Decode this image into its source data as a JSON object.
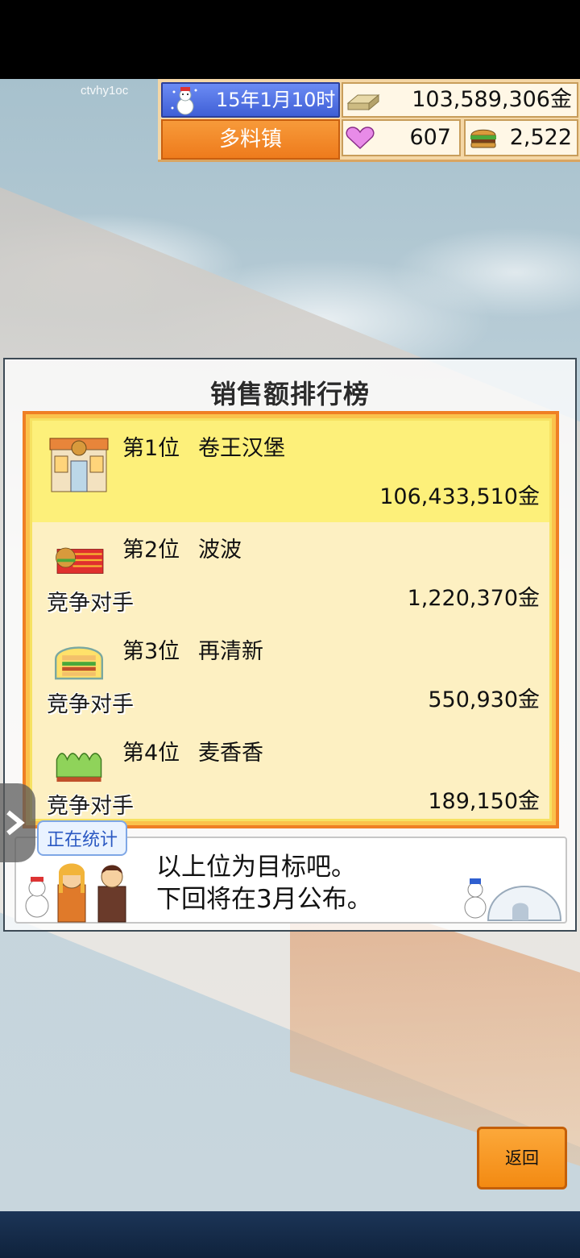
{
  "watermark": "ctvhy1oc",
  "hud": {
    "date": "15年1月10时",
    "town": "多料镇",
    "money": "103,589,306金",
    "hearts": "607",
    "burgers": "2,522"
  },
  "dialog": {
    "title": "销售额排行榜",
    "rankings": [
      {
        "pos": "第1位",
        "name": "卷王汉堡",
        "amount": "106,433,510金",
        "tag": ""
      },
      {
        "pos": "第2位",
        "name": "波波",
        "amount": "1,220,370金",
        "tag": "竞争对手"
      },
      {
        "pos": "第3位",
        "name": "再清新",
        "amount": "550,930金",
        "tag": "竞争对手"
      },
      {
        "pos": "第4位",
        "name": "麦香香",
        "amount": "189,150金",
        "tag": "竞争对手"
      }
    ],
    "badge": "正在统计",
    "message_line1": "以上位为目标吧。",
    "message_line2": "下回将在3月公布。"
  },
  "back_button": "返回",
  "icons": {
    "date": "snowman-icon",
    "money": "gold-bars-icon",
    "hearts": "heart-icon",
    "burgers": "burger-icon"
  }
}
